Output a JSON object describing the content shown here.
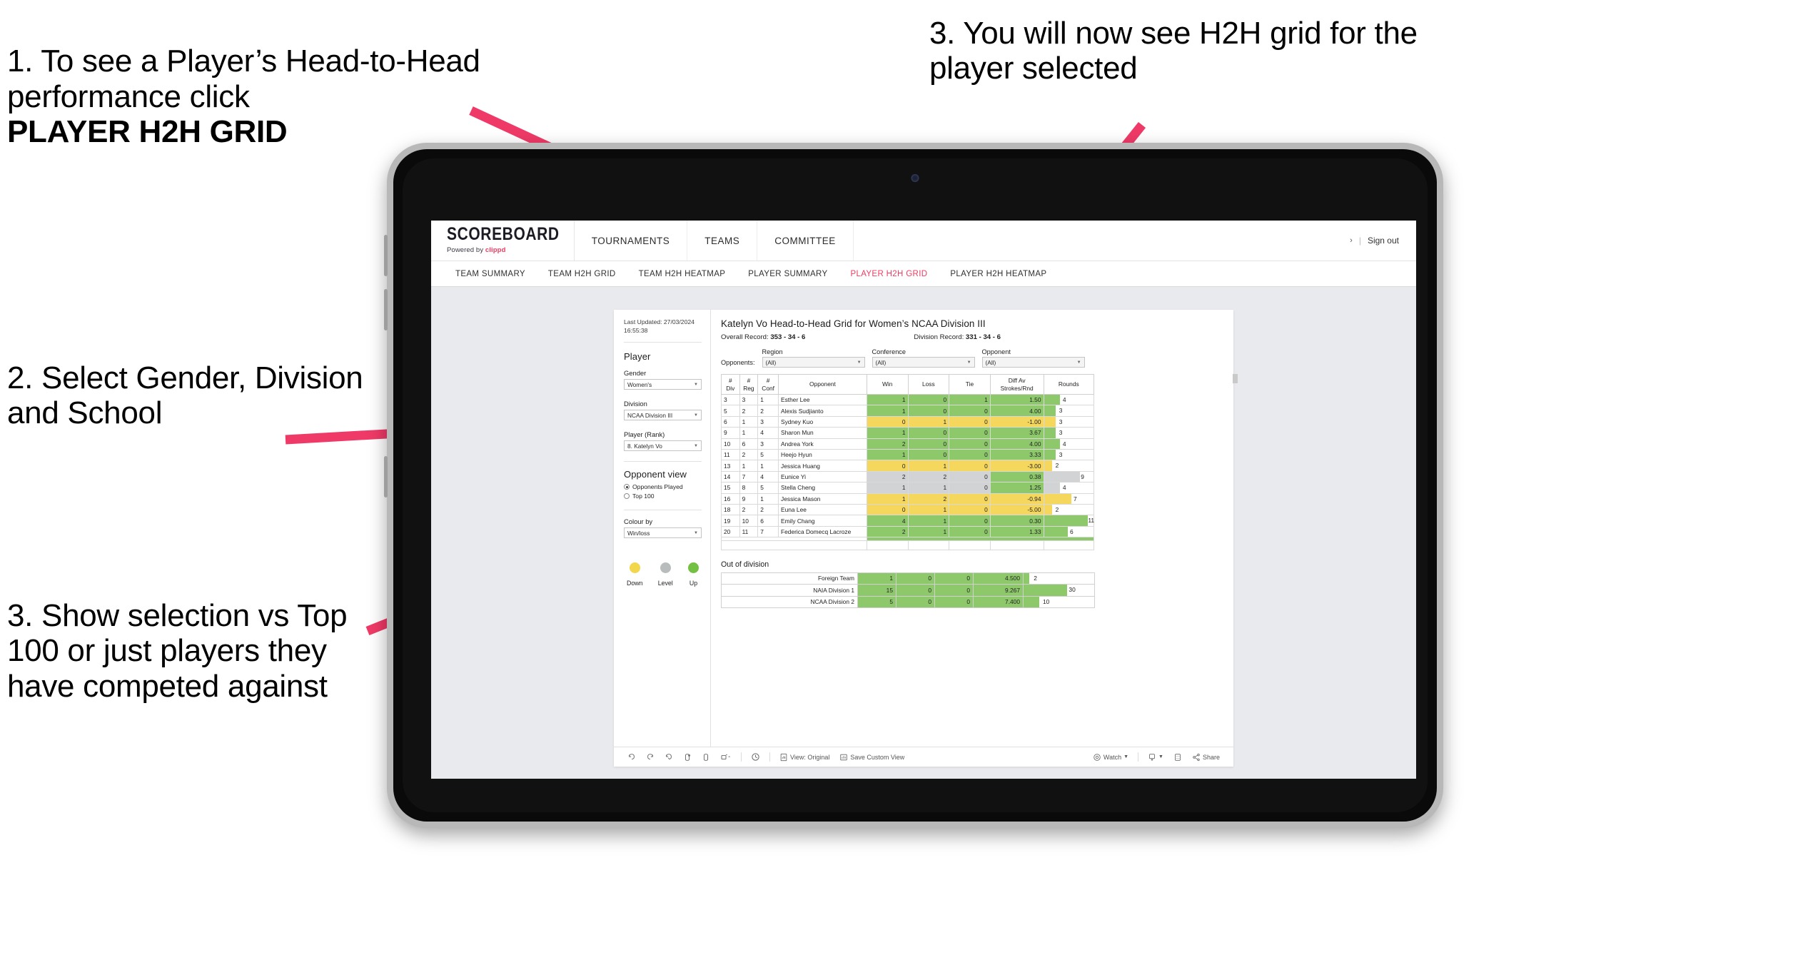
{
  "annotations": {
    "step1": "1. To see a Player’s Head-to-Head performance click ",
    "step1_bold": "PLAYER H2H GRID",
    "step2": "2. Select Gender, Division and School",
    "step3": "3. Show selection vs Top 100 or just players they have competed against",
    "step4": "3. You will now see H2H grid for the player selected"
  },
  "app": {
    "brand_title": "SCOREBOARD",
    "brand_sub_prefix": "Powered by ",
    "brand_sub_name": "clippd",
    "top_nav": [
      "TOURNAMENTS",
      "TEAMS",
      "COMMITTEE"
    ],
    "account_chevron": "›",
    "account_sep": "|",
    "sign_out": "Sign out",
    "accent_color": "#ee3c60"
  },
  "tabs": [
    {
      "label": "TEAM SUMMARY",
      "active": false
    },
    {
      "label": "TEAM H2H GRID",
      "active": false
    },
    {
      "label": "TEAM H2H HEATMAP",
      "active": false
    },
    {
      "label": "PLAYER SUMMARY",
      "active": false
    },
    {
      "label": "PLAYER H2H GRID",
      "active": true
    },
    {
      "label": "PLAYER H2H HEATMAP",
      "active": false
    }
  ],
  "sidebar": {
    "last_updated": "Last Updated: 27/03/2024 16:55:38",
    "player_heading": "Player",
    "gender_label": "Gender",
    "gender_value": "Women's",
    "division_label": "Division",
    "division_value": "NCAA Division III",
    "player_rank_label": "Player (Rank)",
    "player_rank_value": "8. Katelyn Vo",
    "opponent_view_heading": "Opponent view",
    "opponent_view_options": [
      {
        "label": "Opponents Played",
        "selected": true
      },
      {
        "label": "Top 100",
        "selected": false
      }
    ],
    "colour_by_label": "Colour by",
    "colour_by_value": "Win/loss",
    "legend": [
      {
        "label": "Down",
        "color": "#f2d64b"
      },
      {
        "label": "Level",
        "color": "#b9bcbd"
      },
      {
        "label": "Up",
        "color": "#74c043"
      }
    ]
  },
  "main": {
    "title": "Katelyn Vo Head-to-Head Grid for Women’s NCAA Division III",
    "overall_record_label": "Overall Record: ",
    "overall_record_value": "353 - 34 - 6",
    "division_record_label": "Division Record: ",
    "division_record_value": "331 - 34 - 6",
    "opponents_label": "Opponents:",
    "filters": [
      {
        "label": "Region",
        "value": "(All)"
      },
      {
        "label": "Conference",
        "value": "(All)"
      },
      {
        "label": "Opponent",
        "value": "(All)"
      }
    ],
    "columns": [
      "# Div",
      "# Reg",
      "# Conf",
      "Opponent",
      "Win",
      "Loss",
      "Tie",
      "Diff Av Strokes/Rnd",
      "Rounds"
    ],
    "rows": [
      {
        "div": "3",
        "reg": "3",
        "conf": "1",
        "opponent": "Esther Lee",
        "win": "1",
        "loss": "0",
        "tie": "1",
        "diff": "1.50",
        "rounds": "4",
        "color": "#8dc96b",
        "bar": 32
      },
      {
        "div": "5",
        "reg": "2",
        "conf": "2",
        "opponent": "Alexis Sudjianto",
        "win": "1",
        "loss": "0",
        "tie": "0",
        "diff": "4.00",
        "rounds": "3",
        "color": "#8dc96b",
        "bar": 24
      },
      {
        "div": "6",
        "reg": "1",
        "conf": "3",
        "opponent": "Sydney Kuo",
        "win": "0",
        "loss": "1",
        "tie": "0",
        "diff": "-1.00",
        "rounds": "3",
        "color": "#f5d75e",
        "bar": 24
      },
      {
        "div": "9",
        "reg": "1",
        "conf": "4",
        "opponent": "Sharon Mun",
        "win": "1",
        "loss": "0",
        "tie": "0",
        "diff": "3.67",
        "rounds": "3",
        "color": "#8dc96b",
        "bar": 24
      },
      {
        "div": "10",
        "reg": "6",
        "conf": "3",
        "opponent": "Andrea York",
        "win": "2",
        "loss": "0",
        "tie": "0",
        "diff": "4.00",
        "rounds": "4",
        "color": "#8dc96b",
        "bar": 32
      },
      {
        "div": "11",
        "reg": "2",
        "conf": "5",
        "opponent": "Heejo Hyun",
        "win": "1",
        "loss": "0",
        "tie": "0",
        "diff": "3.33",
        "rounds": "3",
        "color": "#8dc96b",
        "bar": 24
      },
      {
        "div": "13",
        "reg": "1",
        "conf": "1",
        "opponent": "Jessica Huang",
        "win": "0",
        "loss": "1",
        "tie": "0",
        "diff": "-3.00",
        "rounds": "2",
        "color": "#f5d75e",
        "bar": 16
      },
      {
        "div": "14",
        "reg": "7",
        "conf": "4",
        "opponent": "Eunice Yi",
        "win": "2",
        "loss": "2",
        "tie": "0",
        "diff": "0.38",
        "rounds": "9",
        "color": "#d2d3d4",
        "diff_color": "#8dc96b",
        "bar": 72
      },
      {
        "div": "15",
        "reg": "8",
        "conf": "5",
        "opponent": "Stella Cheng",
        "win": "1",
        "loss": "1",
        "tie": "0",
        "diff": "1.25",
        "rounds": "4",
        "color": "#d2d3d4",
        "diff_color": "#8dc96b",
        "bar": 32
      },
      {
        "div": "16",
        "reg": "9",
        "conf": "1",
        "opponent": "Jessica Mason",
        "win": "1",
        "loss": "2",
        "tie": "0",
        "diff": "-0.94",
        "rounds": "7",
        "color": "#f5d75e",
        "bar": 56
      },
      {
        "div": "18",
        "reg": "2",
        "conf": "2",
        "opponent": "Euna Lee",
        "win": "0",
        "loss": "1",
        "tie": "0",
        "diff": "-5.00",
        "rounds": "2",
        "color": "#f5d75e",
        "bar": 16
      },
      {
        "div": "19",
        "reg": "10",
        "conf": "6",
        "opponent": "Emily Chang",
        "win": "4",
        "loss": "1",
        "tie": "0",
        "diff": "0.30",
        "rounds": "11",
        "color": "#8dc96b",
        "bar": 88
      },
      {
        "div": "20",
        "reg": "11",
        "conf": "7",
        "opponent": "Federica Domecq Lacroze",
        "win": "2",
        "loss": "1",
        "tie": "0",
        "diff": "1.33",
        "rounds": "6",
        "color": "#8dc96b",
        "bar": 48
      }
    ],
    "out_of_division_title": "Out of division",
    "out_of_division_rows": [
      {
        "name": "Foreign Team",
        "win": "1",
        "loss": "0",
        "tie": "0",
        "diff": "4.500",
        "rounds": "2",
        "color": "#8dc96b",
        "bar": 8
      },
      {
        "name": "NAIA Division 1",
        "win": "15",
        "loss": "0",
        "tie": "0",
        "diff": "9.267",
        "rounds": "30",
        "color": "#8dc96b",
        "bar": 62
      },
      {
        "name": "NCAA Division 2",
        "win": "5",
        "loss": "0",
        "tie": "0",
        "diff": "7.400",
        "rounds": "10",
        "color": "#8dc96b",
        "bar": 22
      }
    ]
  },
  "toolbar": {
    "view_label": "View: Original",
    "save_label": "Save Custom View",
    "watch_label": "Watch",
    "share_label": "Share"
  }
}
